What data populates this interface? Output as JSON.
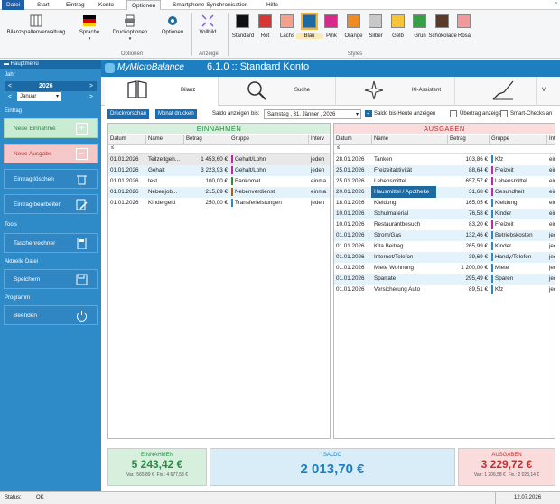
{
  "menu": {
    "items": [
      "Datei",
      "Start",
      "Eintrag",
      "Konto",
      "Optionen",
      "Smartphone Synchronisation",
      "Hilfe"
    ]
  },
  "ribbon": {
    "buttons": {
      "bilanz": "Bilanzspaltenverwaltung",
      "sprache": "Sprache",
      "druck": "Druckoptionen",
      "optionen": "Optionen",
      "vollbild": "Vollbild"
    },
    "groups": {
      "optionen": "Optionen",
      "anzeige": "Anzeige",
      "styles": "Styles"
    },
    "styles": [
      {
        "label": "Standard",
        "color": "#111111"
      },
      {
        "label": "Rot",
        "color": "#d93535"
      },
      {
        "label": "Lachs",
        "color": "#f4a08a"
      },
      {
        "label": "Blau",
        "color": "#1d6aa0"
      },
      {
        "label": "Pink",
        "color": "#d82a8a"
      },
      {
        "label": "Orange",
        "color": "#f08a1e"
      },
      {
        "label": "Silber",
        "color": "#c8c8c8"
      },
      {
        "label": "Gelb",
        "color": "#f5c43a"
      },
      {
        "label": "Grün",
        "color": "#35a047"
      },
      {
        "label": "Schokolade",
        "color": "#5a3b2a"
      },
      {
        "label": "Rosa",
        "color": "#f29a9a"
      }
    ]
  },
  "sidebar": {
    "hauptmenu": "Hauptmenü",
    "jahr": "Jahr",
    "year": "2026",
    "month": "Januar",
    "eintrag": "Eintrag",
    "neue_einnahme": "Neue Einnahme",
    "neue_ausgabe": "Neue Ausgabe",
    "loeschen": "Eintrag löschen",
    "bearbeiten": "Eintrag bearbeiten",
    "tools": "Tools",
    "rechner": "Taschenrechner",
    "datei": "Aktuelle Datei",
    "speichern": "Speichern",
    "programm": "Programm",
    "beenden": "Beenden"
  },
  "header": {
    "logo": "MyMicroBalance",
    "title": "6.1.0  :: Standard Konto"
  },
  "tabs": {
    "bilanz": "Bilanz",
    "suche": "Suche",
    "ki": "KI-Assistent"
  },
  "toolbar": {
    "druckvorschau": "Druckvorschau",
    "monat_drucken": "Monat drucken",
    "saldo_label": "Saldo anzeigen bis:",
    "date": "Samstag  ,  31.  Jänner  ,  2026",
    "cb1": "Saldo bis Heute anzeigen",
    "cb2": "Übertrag anzeigen",
    "cb3": "Smart-Checks an"
  },
  "einnahmen": {
    "title": "EINNAHMEN",
    "headers": [
      "Datum",
      "Name",
      "Betrag",
      "Gruppe",
      "Interv"
    ],
    "filter": "≤",
    "rows": [
      {
        "datum": "01.01.2026",
        "name": "Teilzeitgeh...",
        "betrag": "1 453,60 €",
        "gruppe": "Gehalt/Lohn",
        "color": "#c02aa0",
        "int": "jeden"
      },
      {
        "datum": "01.01.2026",
        "name": "Gehalt",
        "betrag": "3 223,93 €",
        "gruppe": "Gehalt/Lohn",
        "color": "#c02aa0",
        "int": "jeden"
      },
      {
        "datum": "01.01.2026",
        "name": "test",
        "betrag": "100,00 €",
        "gruppe": "Bankomat",
        "color": "#3a8a3a",
        "int": "einma"
      },
      {
        "datum": "01.01.2026",
        "name": "Nebenjob...",
        "betrag": "215,89 €",
        "gruppe": "Nebenverdienst",
        "color": "#a06020",
        "int": "einma"
      },
      {
        "datum": "01.01.2026",
        "name": "Kindergeld",
        "betrag": "250,00 €",
        "gruppe": "Transferleistungen",
        "color": "#2f86c2",
        "int": "jeden"
      }
    ]
  },
  "ausgaben": {
    "title": "AUSGABEN",
    "headers": [
      "Datum",
      "Name",
      "Betrag",
      "Gruppe",
      "Int"
    ],
    "filter": "≤",
    "rows": [
      {
        "datum": "28.01.2026",
        "name": "Tanken",
        "betrag": "103,86 €",
        "gruppe": "Kfz",
        "color": "#2f86c2",
        "int": "ein"
      },
      {
        "datum": "25.01.2026",
        "name": "Freizeitaktivität",
        "betrag": "88,64 €",
        "gruppe": "Freizeit",
        "color": "#c02aa0",
        "int": "ein"
      },
      {
        "datum": "25.01.2026",
        "name": "Lebensmittel",
        "betrag": "657,57 €",
        "gruppe": "Lebensmittel",
        "color": "#c02aa0",
        "int": "ein"
      },
      {
        "datum": "20.01.2026",
        "name": "Hausmittel / Apotheke",
        "betrag": "31,68 €",
        "gruppe": "Gesundheit",
        "color": "#c02aa0",
        "int": "ein"
      },
      {
        "datum": "18.01.2026",
        "name": "Kleidung",
        "betrag": "165,05 €",
        "gruppe": "Kleidung",
        "color": "#2f86c2",
        "int": "ein"
      },
      {
        "datum": "10.01.2026",
        "name": "Schulmaterial",
        "betrag": "76,58 €",
        "gruppe": "Kinder",
        "color": "#2f86c2",
        "int": "ein"
      },
      {
        "datum": "10.01.2026",
        "name": "Restaurantbesuch",
        "betrag": "83,20 €",
        "gruppe": "Freizeit",
        "color": "#c02aa0",
        "int": "ein"
      },
      {
        "datum": "01.01.2026",
        "name": "Strom/Gas",
        "betrag": "132,46 €",
        "gruppe": "Betriebskosten",
        "color": "#2f86c2",
        "int": "jed"
      },
      {
        "datum": "01.01.2026",
        "name": "Kita Beitrag",
        "betrag": "265,99 €",
        "gruppe": "Kinder",
        "color": "#2f86c2",
        "int": "jed"
      },
      {
        "datum": "01.01.2026",
        "name": "Internet/Telefon",
        "betrag": "39,69 €",
        "gruppe": "Handy/Telefon",
        "color": "#2f86c2",
        "int": "jed"
      },
      {
        "datum": "01.01.2026",
        "name": "Miete Wohnung",
        "betrag": "1 200,00 €",
        "gruppe": "Miete",
        "color": "#2f86c2",
        "int": "jed"
      },
      {
        "datum": "01.01.2026",
        "name": "Sparrate",
        "betrag": "295,49 €",
        "gruppe": "Sparen",
        "color": "#2f86c2",
        "int": "jed"
      },
      {
        "datum": "01.01.2026",
        "name": "Versicherung Auto",
        "betrag": "89,51 €",
        "gruppe": "Kfz",
        "color": "#2f86c2",
        "int": "jed"
      }
    ]
  },
  "summary": {
    "ein_label": "EINNAHMEN",
    "ein_value": "5 243,42 €",
    "ein_var": "Var.: 565,89 €",
    "ein_fix": "Fix.: 4 677,53 €",
    "saldo_label": "SALDO",
    "saldo_value": "2 013,70 €",
    "aus_label": "AUSGABEN",
    "aus_value": "3 229,72 €",
    "aus_var": "Var.: 1 206,58 €",
    "aus_fix": "Fix.: 2 023,14 €"
  },
  "status": {
    "label": "Status:",
    "value": "OK",
    "date": "12.07.2026"
  }
}
